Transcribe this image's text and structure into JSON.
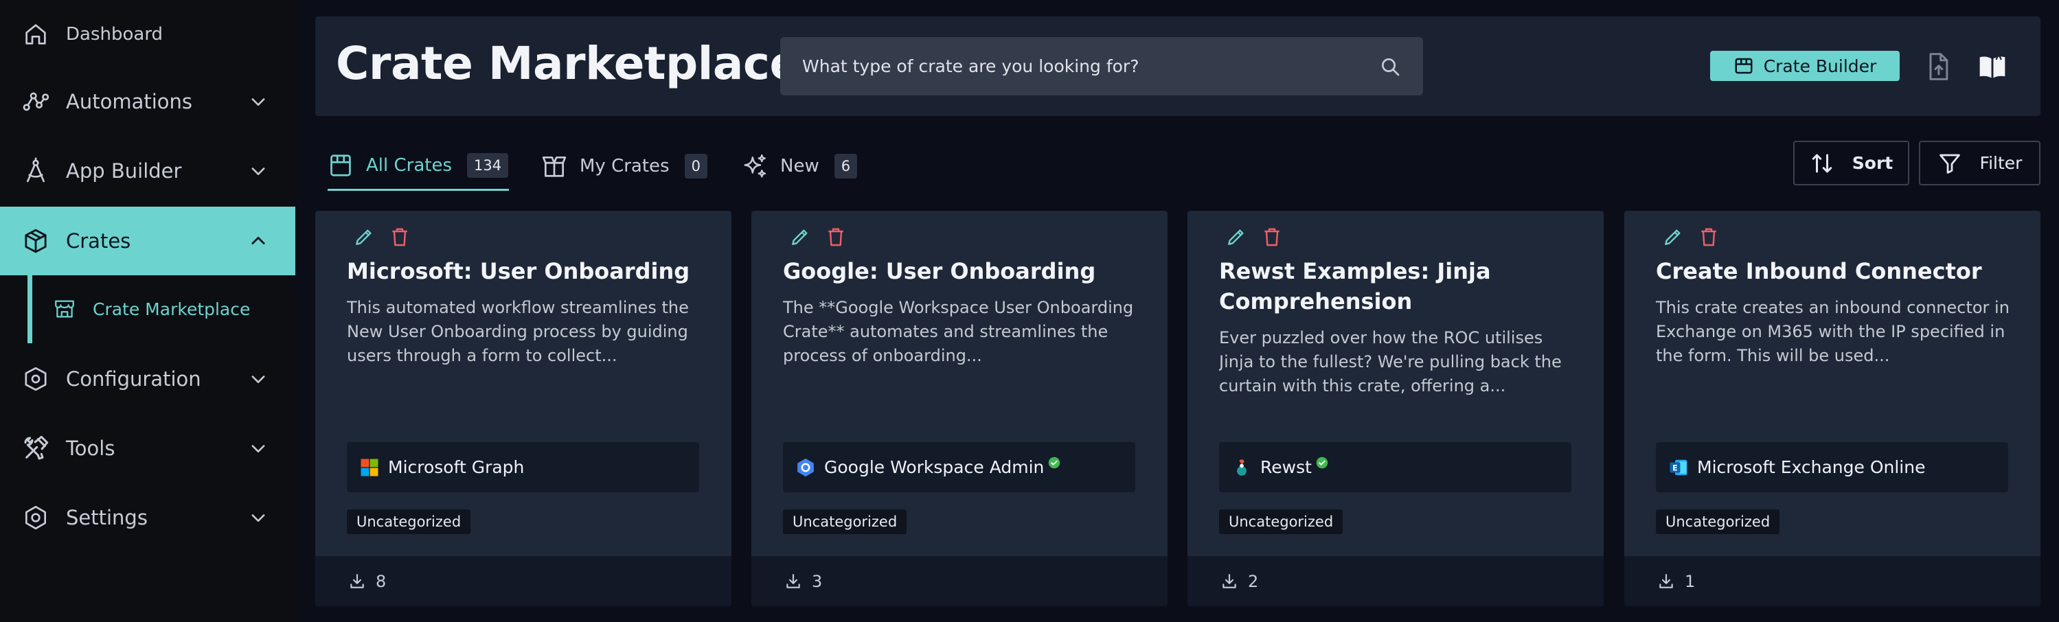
{
  "sidebar": {
    "items": [
      {
        "label": "Dashboard",
        "icon": "home-icon"
      },
      {
        "label": "Automations",
        "icon": "workflow-icon"
      },
      {
        "label": "App Builder",
        "icon": "compass-icon"
      },
      {
        "label": "Crates",
        "icon": "package-icon",
        "active": true
      },
      {
        "label": "Configuration",
        "icon": "hexagon-icon"
      },
      {
        "label": "Tools",
        "icon": "tools-icon"
      },
      {
        "label": "Settings",
        "icon": "gear-icon"
      }
    ],
    "subitem": {
      "label": "Crate Marketplace",
      "icon": "storefront-icon"
    }
  },
  "header": {
    "title": "Crate Marketplace",
    "search_placeholder": "What type of crate are you looking for?",
    "crate_builder_label": "Crate Builder"
  },
  "tabs": [
    {
      "label": "All Crates",
      "count": "134",
      "active": true
    },
    {
      "label": "My Crates",
      "count": "0"
    },
    {
      "label": "New",
      "count": "6"
    }
  ],
  "toolbar": {
    "sort_label": "Sort",
    "filter_label": "Filter"
  },
  "cards": [
    {
      "title": "Microsoft: User Onboarding",
      "description": "This automated workflow streamlines the New User Onboarding process by guiding users through a form to collect...",
      "integration": "Microsoft Graph",
      "verified": false,
      "tag": "Uncategorized",
      "downloads": "8"
    },
    {
      "title": "Google: User Onboarding",
      "description": "The **Google Workspace User Onboarding Crate** automates and streamlines the process of onboarding...",
      "integration": "Google Workspace Admin",
      "verified": true,
      "tag": "Uncategorized",
      "downloads": "3"
    },
    {
      "title": "Rewst Examples: Jinja Comprehension",
      "description": "Ever puzzled over how the ROC utilises Jinja to the fullest? We're pulling back the curtain with this crate, offering a...",
      "integration": "Rewst",
      "verified": true,
      "tag": "Uncategorized",
      "downloads": "2"
    },
    {
      "title": "Create Inbound Connector",
      "description": "This crate creates an inbound connector in Exchange on M365 with the IP specified in the form. This will be used...",
      "integration": "Microsoft Exchange Online",
      "verified": false,
      "tag": "Uncategorized",
      "downloads": "1"
    }
  ],
  "colors": {
    "accent": "#6dd3cf",
    "danger": "#ef5f6b",
    "verified": "#3fb950"
  }
}
